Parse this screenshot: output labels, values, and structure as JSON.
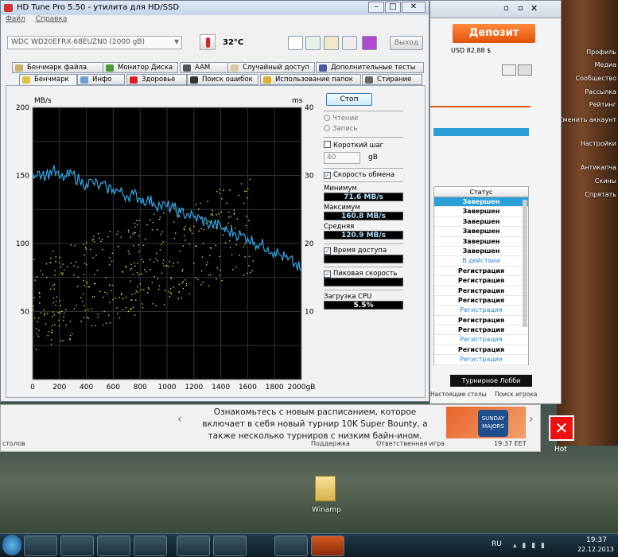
{
  "hdtune": {
    "title": "HD Tune Pro 5.50 - утилита для HD/SSD",
    "menu": [
      "Файл",
      "Справка"
    ],
    "drive": "WDC WD20EFRX-68EUZN0 (2000 gB)",
    "temp": "32°C",
    "exit": "Выход",
    "tabs_top": [
      "Бенчмарк файла",
      "Монитор Диска",
      "AAM",
      "Случайный доступ",
      "Дополнительные тесты"
    ],
    "tabs_bottom": [
      "Бенчмарк",
      "Инфо",
      "Здоровье",
      "Поиск ошибок",
      "Использование папок",
      "Стирание"
    ],
    "stop": "Стоп",
    "read": "Чтение",
    "write": "Запись",
    "short_stroke": "Короткий шаг",
    "short_val": "40",
    "gb": "gB",
    "transfer_rate": "Скорость обмена",
    "min_label": "Минимум",
    "min": "71.6 MB/s",
    "max_label": "Максимум",
    "max": "160.8 MB/s",
    "avg_label": "Средняя",
    "avg": "120.9 MB/s",
    "access_time": "Время доступа",
    "burst": "Пиковая скорость",
    "cpu_label": "Загрузка CPU",
    "cpu": "5.5%"
  },
  "chart_data": {
    "type": "line",
    "title": "",
    "xlabel": "gB",
    "ylabel": "MB/s",
    "y2label": "ms",
    "xlim": [
      0,
      2000
    ],
    "ylim": [
      0,
      200
    ],
    "y2lim": [
      0,
      40
    ],
    "xticks": [
      "0",
      "200",
      "400",
      "600",
      "800",
      "1000",
      "1200",
      "1400",
      "1600",
      "1800",
      "2000gB"
    ],
    "yticks": [
      "50",
      "100",
      "150",
      "200"
    ],
    "y2ticks": [
      "10",
      "20",
      "30",
      "40"
    ],
    "series": [
      {
        "name": "",
        "color": "#30a8e8",
        "x": [
          0,
          50,
          100,
          150,
          200,
          250,
          300,
          350,
          400,
          450,
          500,
          550,
          600,
          650,
          700,
          750,
          800,
          850,
          900,
          950,
          1000,
          1050,
          1100,
          1150,
          1200,
          1250,
          1300,
          1350,
          1400,
          1450,
          1500,
          1550,
          1600,
          1650,
          1700,
          1750,
          1800,
          1850,
          1900,
          1950,
          2000
        ],
        "values": [
          152,
          153,
          150,
          154,
          148,
          149,
          151,
          146,
          144,
          145,
          142,
          141,
          140,
          138,
          135,
          136,
          133,
          132,
          130,
          128,
          127,
          126,
          122,
          122,
          119,
          118,
          115,
          114,
          112,
          109,
          108,
          106,
          104,
          101,
          99,
          97,
          94,
          91,
          88,
          85,
          80
        ]
      }
    ],
    "scatter_color": "#d8d83a"
  },
  "poker": {
    "deposit": "Депозит",
    "balance": "USD 82,88 $",
    "status_header": "Статус",
    "rows": [
      "Завершен",
      "Завершен",
      "Завершен",
      "Завершен",
      "Завершен",
      "Завершен",
      "В действии",
      "Регистрация",
      "Регистрация",
      "Регистрация",
      "Регистрация",
      "Регистрация",
      "Регистрация",
      "Регистрация",
      "Регистрация",
      "Регистрация",
      "Регистрация"
    ],
    "lobby": "Турнирное Лобби",
    "links": [
      "Настоящие столы",
      "Поиск игрока"
    ]
  },
  "side": [
    "Профиль",
    "Медиа",
    "Сообщество",
    "Рассылка",
    "Рейтинг",
    "Сменить аккаунт",
    "Настройки",
    "Антикапча",
    "Скины",
    "Спрятать"
  ],
  "banner": {
    "text": "Ознакомьтесь с новым расписанием, которое включает в себя новый турнир 10K Super Bounty, а также несколько турниров с низким байн-ином.",
    "badge": "SUNDAY MAJORS",
    "support": "Поддержка",
    "responsible": "Ответственная игра",
    "time": "19:37 EET",
    "tables": "столов"
  },
  "hot": "Hot",
  "winamp": "Winamp",
  "tray": {
    "lang": "RU",
    "time": "19:37",
    "date": "22.12.2013"
  }
}
